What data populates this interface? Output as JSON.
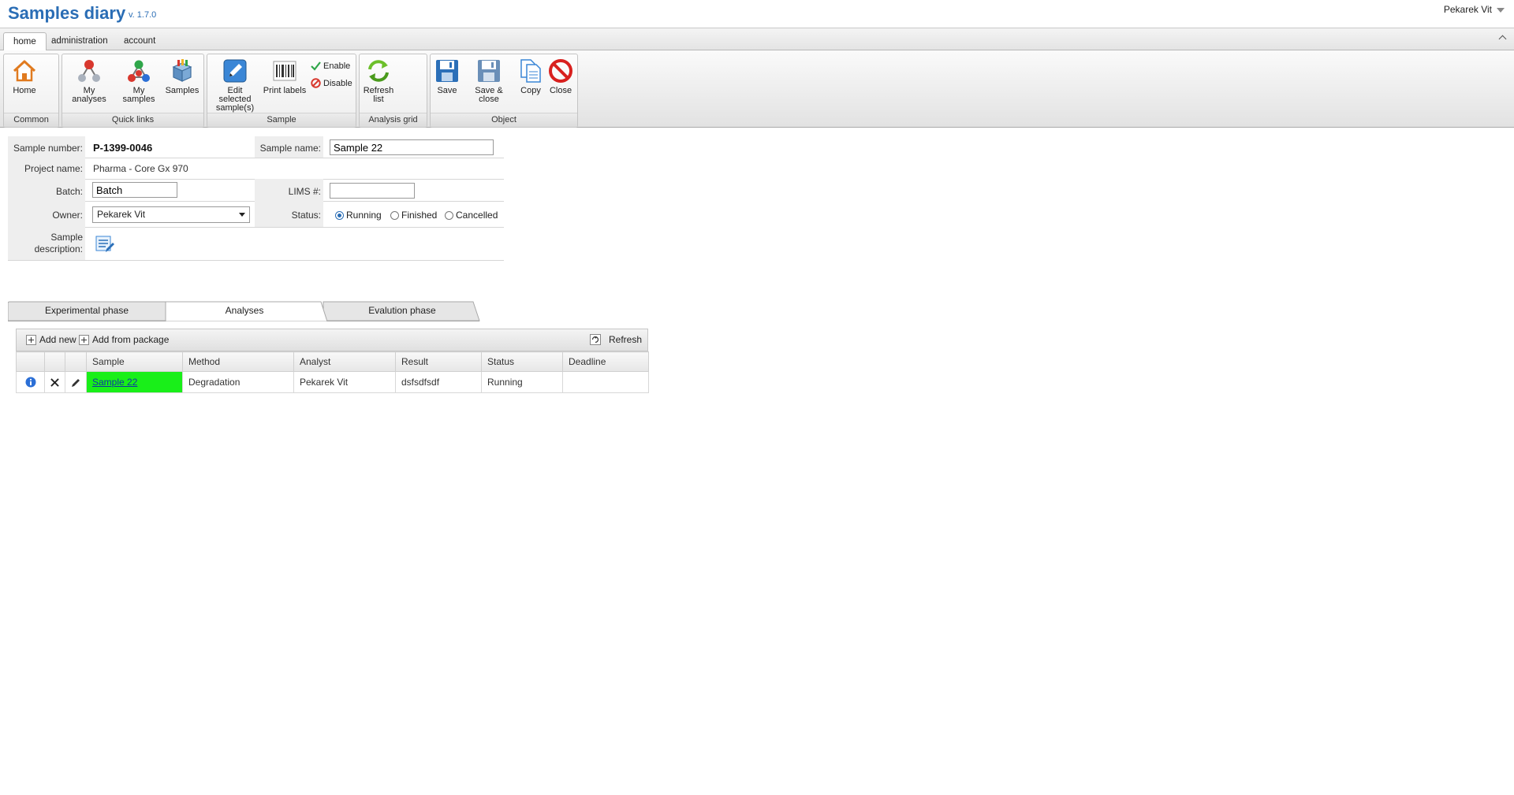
{
  "app": {
    "title": "Samples diary",
    "version": "v. 1.7.0",
    "user": "Pekarek Vit"
  },
  "ribbon_tabs": [
    "home",
    "administration",
    "account"
  ],
  "ribbon": {
    "groups": {
      "common": "Common",
      "quick_links": "Quick links",
      "sample": "Sample",
      "analysis_grid": "Analysis grid",
      "object": "Object"
    },
    "buttons": {
      "home": "Home",
      "my_analyses": "My analyses",
      "my_samples": "My samples",
      "samples": "Samples",
      "edit_selected": "Edit selected sample(s)",
      "print_labels": "Print labels",
      "enable": "Enable",
      "disable": "Disable",
      "refresh_list": "Refresh list",
      "save": "Save",
      "save_close": "Save & close",
      "copy": "Copy",
      "close": "Close"
    }
  },
  "form": {
    "sample_number_label": "Sample number:",
    "sample_number": "P-1399-0046",
    "sample_name_label": "Sample name:",
    "sample_name": "Sample 22",
    "project_name_label": "Project name:",
    "project_name": "Pharma - Core Gx 970",
    "batch_label": "Batch:",
    "batch": "Batch",
    "lims_label": "LIMS #:",
    "lims": "",
    "owner_label": "Owner:",
    "owner": "Pekarek Vit",
    "status_label": "Status:",
    "status_options": [
      "Running",
      "Finished",
      "Cancelled"
    ],
    "status_selected": "Running",
    "description_label_1": "Sample",
    "description_label_2": "description:"
  },
  "phase_tabs": [
    "Experimental phase",
    "Analyses",
    "Evalution phase"
  ],
  "active_phase_tab": "Analyses",
  "grid": {
    "toolbar": {
      "add_new": "Add new",
      "add_from_package": "Add from package",
      "refresh": "Refresh"
    },
    "columns": [
      "Sample",
      "Method",
      "Analyst",
      "Result",
      "Status",
      "Deadline"
    ],
    "rows": [
      {
        "sample": "Sample 22",
        "method": "Degradation",
        "analyst": "Pekarek Vit",
        "result": "dsfsdfsdf",
        "status": "Running",
        "deadline": ""
      }
    ]
  },
  "colors": {
    "brand": "#2a6db5",
    "sample_highlight": "#19ef19"
  }
}
